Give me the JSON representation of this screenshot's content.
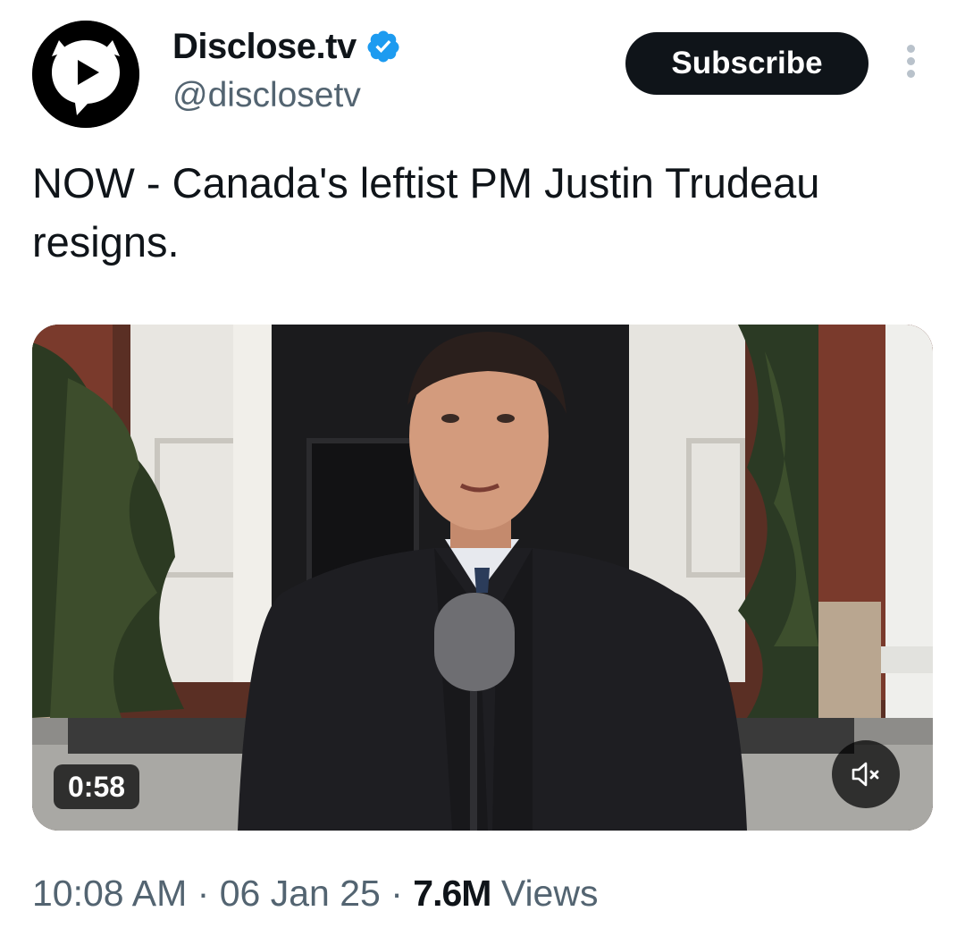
{
  "author": {
    "display_name": "Disclose.tv",
    "handle": "@disclosetv",
    "verified": true,
    "avatar_icon": "play-speech-bubble-logo"
  },
  "actions": {
    "subscribe_label": "Subscribe",
    "more_icon": "more-vertical-icon"
  },
  "tweet": {
    "text": "NOW - Canada's leftist PM Justin Trudeau resigns."
  },
  "media": {
    "type": "video",
    "duration": "0:58",
    "muted": true,
    "mute_icon": "speaker-muted-icon"
  },
  "meta": {
    "time": "10:08 AM",
    "separator": "·",
    "date": "06 Jan 25",
    "views_count": "7.6M",
    "views_label": "Views"
  },
  "colors": {
    "text_primary": "#0f1419",
    "text_secondary": "#536471",
    "verified_blue": "#1d9bf0",
    "button_bg": "#0f1419"
  }
}
